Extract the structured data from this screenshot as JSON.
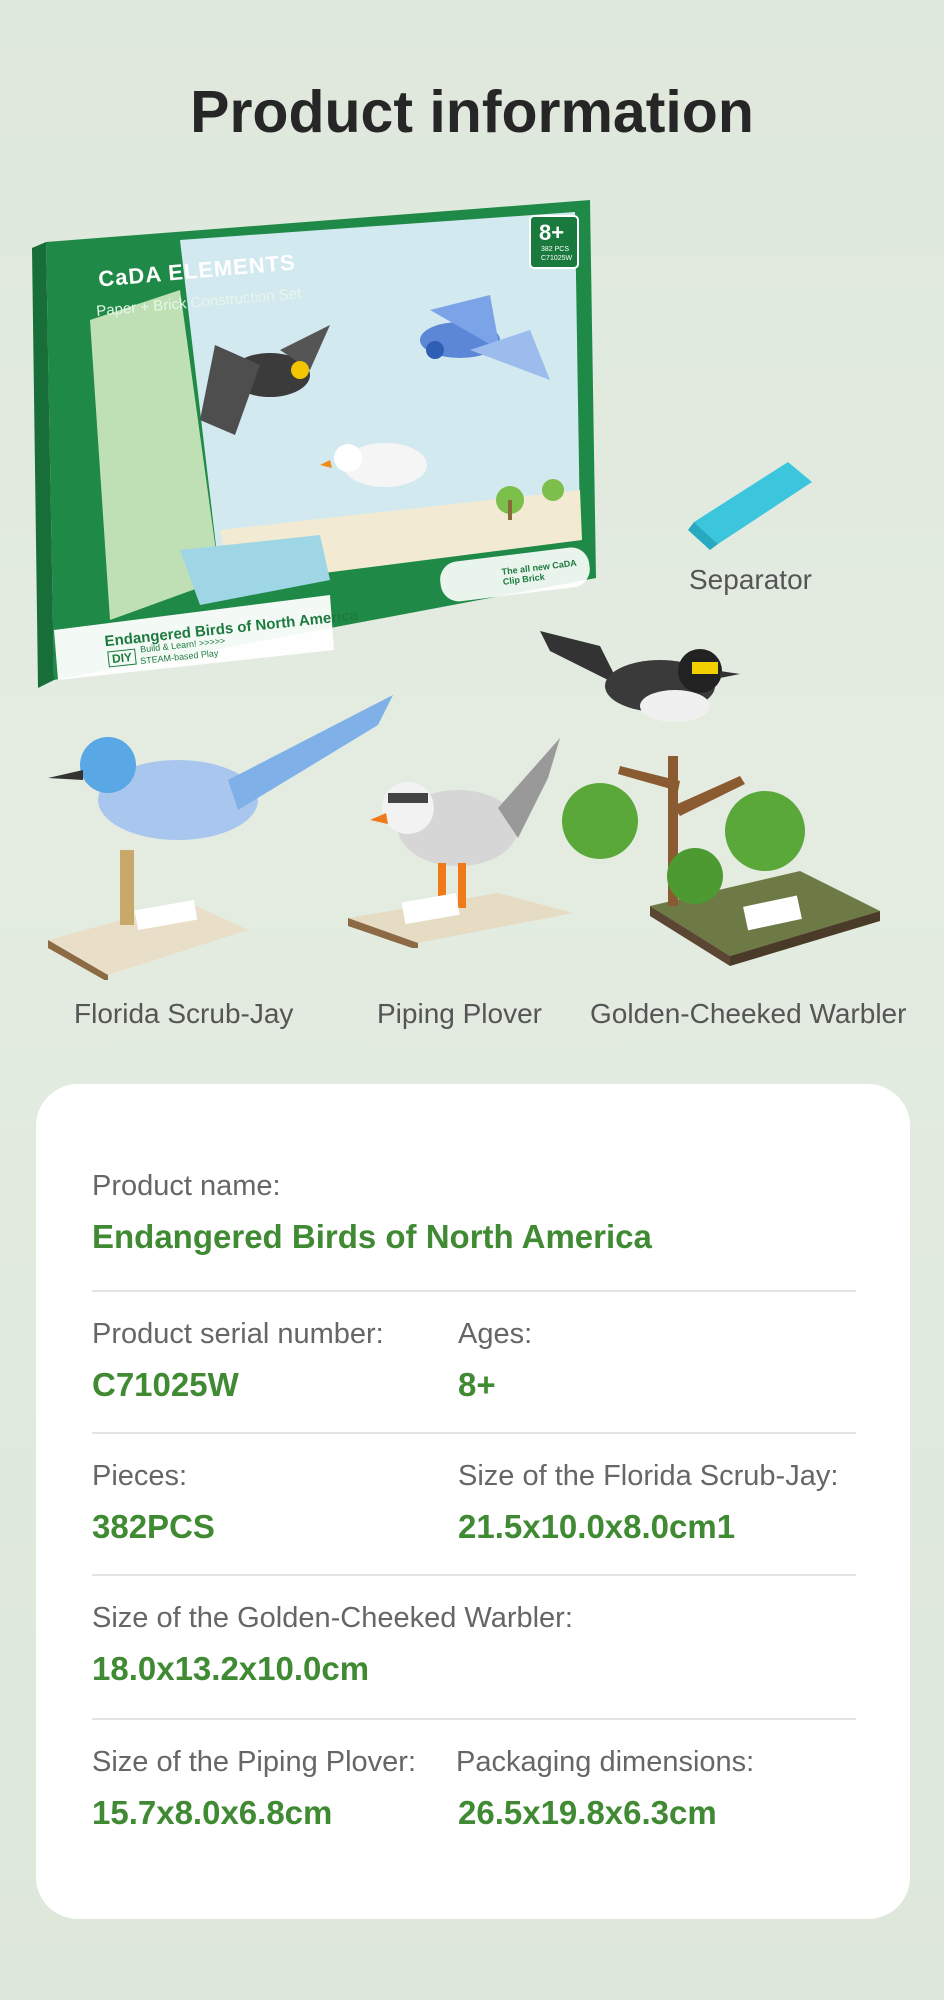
{
  "page_title": "Product information",
  "box": {
    "brand": "CaDA ELEMENTS",
    "subtitle": "Paper + Brick Construction Set",
    "age": "8+",
    "pcs": "382 PCS",
    "serial": "C71025W",
    "set_name": "Endangered Birds of North America",
    "diy": "DIY",
    "tagline_1": "Build & Learn! >>>>>",
    "tagline_2": "STEAM-based Play",
    "clip_brick": "The all new CaDA Clip Brick",
    "colors": {
      "box_green": "#1f8a47",
      "sky": "#cde6ef"
    }
  },
  "captions": {
    "separator": "Separator",
    "scrub_jay": "Florida Scrub-Jay",
    "plover": "Piping Plover",
    "warbler": "Golden-Cheeked Warbler"
  },
  "info": {
    "product_name_label": "Product name:",
    "product_name": "Endangered Birds of North America",
    "serial_label": "Product serial number:",
    "serial": "C71025W",
    "ages_label": "Ages:",
    "ages": "8+",
    "pieces_label": "Pieces:",
    "pieces": "382PCS",
    "scrub_jay_size_label": "Size of the Florida Scrub-Jay:",
    "scrub_jay_size": "21.5x10.0x8.0cm1",
    "warbler_size_label": "Size of the Golden-Cheeked Warbler:",
    "warbler_size": "18.0x13.2x10.0cm",
    "plover_size_label": "Size of the Piping Plover:",
    "plover_size": "15.7x8.0x6.8cm",
    "packaging_label": "Packaging dimensions:",
    "packaging": "26.5x19.8x6.3cm"
  },
  "colors": {
    "accent_green": "#3f8a32",
    "label_gray": "#666666",
    "title": "#262626"
  }
}
